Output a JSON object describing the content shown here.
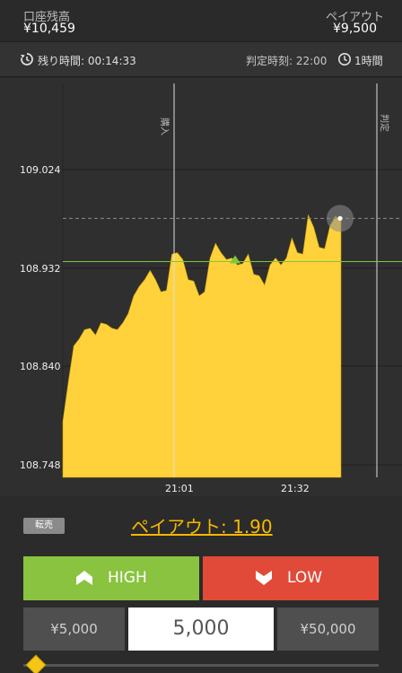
{
  "header": {
    "balance_label": "口座残高",
    "balance_value": "¥10,459",
    "payout_label": "ペイアウト",
    "payout_value": "¥9,500"
  },
  "infobar": {
    "remaining_label": "残り時間: 00:14:33",
    "judge_label": "判定時刻: 22:00",
    "period_label": "1時間",
    "remaining_icon": "timer-icon",
    "period_icon": "clock-icon"
  },
  "chart": {
    "y_ticks": [
      "109.024",
      "108.932",
      "108.840",
      "108.748"
    ],
    "x_ticks": [
      "21:01",
      "21:32"
    ],
    "vertical_markers": [
      "購入",
      "判定"
    ],
    "colors": {
      "area": "#ffd23c",
      "target_line": "#7ec83a",
      "grid": "#1d1d1d"
    }
  },
  "chart_data": {
    "type": "area",
    "ylim": [
      108.73,
      109.1
    ],
    "y_ticks": [
      109.024,
      108.932,
      108.84,
      108.748
    ],
    "x_ticks": [
      "21:01",
      "21:32"
    ],
    "target_price": 108.93,
    "current_price": 108.97,
    "values": [
      108.78,
      108.82,
      108.85,
      108.86,
      108.865,
      108.87,
      108.86,
      108.875,
      108.87,
      108.87,
      108.865,
      108.875,
      108.88,
      108.9,
      108.905,
      108.915,
      108.92,
      108.915,
      108.9,
      108.905,
      108.935,
      108.94,
      108.93,
      108.915,
      108.91,
      108.9,
      108.9,
      108.935,
      108.945,
      108.94,
      108.93,
      108.935,
      108.925,
      108.93,
      108.935,
      108.92,
      108.915,
      108.91,
      108.925,
      108.935,
      108.925,
      108.935,
      108.95,
      108.94,
      108.935,
      108.975,
      108.96,
      108.945,
      108.94,
      108.965,
      108.97,
      108.97
    ]
  },
  "controls": {
    "resell_label": "転売",
    "payout_text": "ペイアウト: 1.90",
    "high_label": "HIGH",
    "low_label": "LOW",
    "amount_low": "¥5,000",
    "amount_value": "5,000",
    "amount_high": "¥50,000"
  }
}
